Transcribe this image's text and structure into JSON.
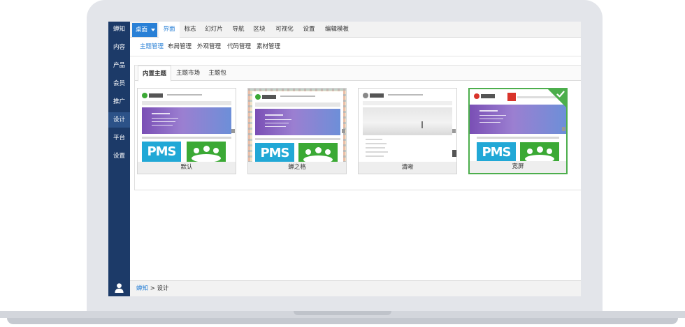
{
  "sidebar": {
    "items": [
      {
        "label": "蝉知"
      },
      {
        "label": "内容"
      },
      {
        "label": "产品"
      },
      {
        "label": "会员"
      },
      {
        "label": "推广"
      },
      {
        "label": "设计"
      },
      {
        "label": "平台"
      },
      {
        "label": "设置"
      }
    ],
    "active": "设计"
  },
  "topbar": {
    "desktop_label": "桌面",
    "tabs": [
      {
        "label": "界面"
      },
      {
        "label": "标志"
      },
      {
        "label": "幻灯片"
      },
      {
        "label": "导航"
      },
      {
        "label": "区块"
      },
      {
        "label": "可视化"
      },
      {
        "label": "设置"
      },
      {
        "label": "编辑模板"
      }
    ],
    "active": "界面"
  },
  "subnav": {
    "tabs": [
      {
        "label": "主题管理"
      },
      {
        "label": "布局管理"
      },
      {
        "label": "外观管理"
      },
      {
        "label": "代码管理"
      },
      {
        "label": "素材管理"
      }
    ],
    "active": "主题管理"
  },
  "panel": {
    "tabs": [
      {
        "label": "内置主题"
      },
      {
        "label": "主题市场"
      },
      {
        "label": "主题包"
      }
    ],
    "active": "内置主题"
  },
  "themes": [
    {
      "label": "默认",
      "pms": "PMS"
    },
    {
      "label": "蝉之格",
      "pms": "PMS"
    },
    {
      "label": "清晰"
    },
    {
      "label": "宽屏",
      "pms": "PMS",
      "selected": true
    }
  ],
  "breadcrumb": {
    "home": "蝉知",
    "separator": ">",
    "current": "设计"
  },
  "colors": {
    "sidebar": "#1c3a68",
    "accent": "#2980d6",
    "selected": "#4cae4c"
  },
  "icons": [
    "user-icon",
    "check-icon",
    "caret-down-icon"
  ]
}
